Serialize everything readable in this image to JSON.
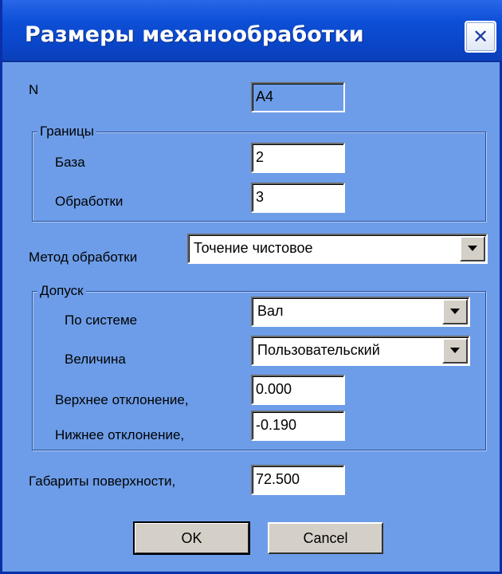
{
  "window": {
    "title": "Размеры механообработки"
  },
  "fields": {
    "n_label": "N",
    "n_value": "A4",
    "bounds_legend": "Границы",
    "base_label": "База",
    "base_value": "2",
    "processing_label": "Обработки",
    "processing_value": "3",
    "method_label": "Метод обработки",
    "method_value": "Точение чистовое",
    "tolerance_legend": "Допуск",
    "system_label": "По системе",
    "system_value": "Вал",
    "magnitude_label": "Величина",
    "magnitude_value": "Пользовательский",
    "upper_label": "Верхнее отклонение,",
    "upper_value": "0.000",
    "lower_label": "Нижнее отклонение,",
    "lower_value": "-0.190",
    "dims_label": "Габариты поверхности,",
    "dims_value": "72.500"
  },
  "buttons": {
    "ok": "OK",
    "cancel": "Cancel"
  }
}
